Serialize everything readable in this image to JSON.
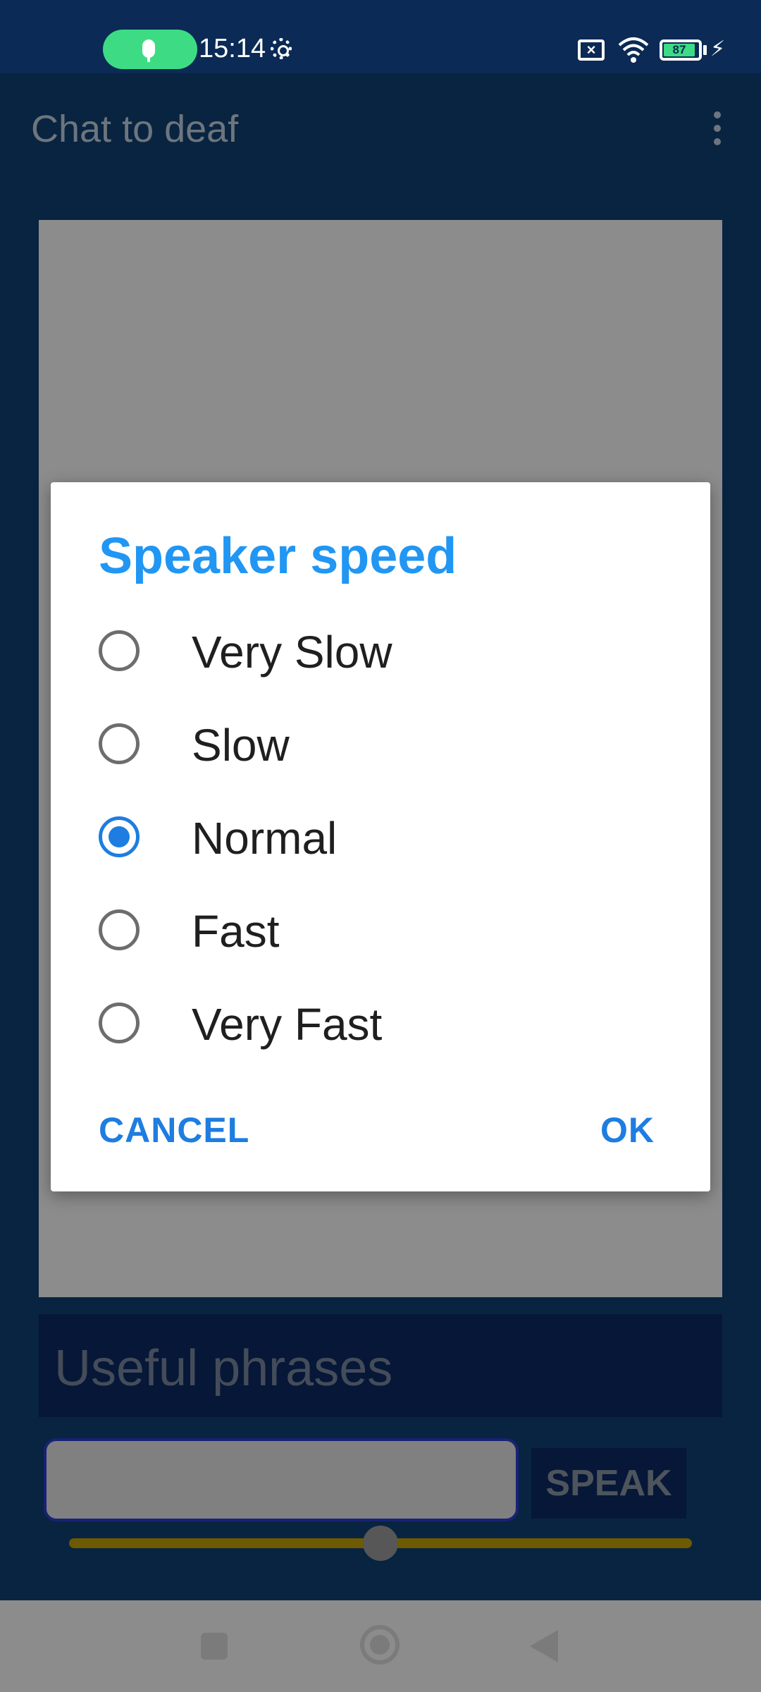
{
  "status_bar": {
    "time": "15:14",
    "battery_level": "87",
    "icons": [
      "microphone-icon",
      "settings-gear-icon",
      "no-sim-icon",
      "wifi-icon",
      "battery-icon",
      "charging-bolt-icon"
    ]
  },
  "app_bar": {
    "title": "Chat to deaf",
    "menu_icon": "more-vert-icon"
  },
  "main": {
    "phrases_label": "Useful phrases",
    "message_input_value": "",
    "speak_button": "SPEAK",
    "slider_value": 0.5
  },
  "dialog": {
    "title": "Speaker speed",
    "options": [
      {
        "label": "Very Slow",
        "selected": false
      },
      {
        "label": "Slow",
        "selected": false
      },
      {
        "label": "Normal",
        "selected": true
      },
      {
        "label": "Fast",
        "selected": false
      },
      {
        "label": "Very Fast",
        "selected": false
      }
    ],
    "cancel_label": "CANCEL",
    "ok_label": "OK"
  },
  "colors": {
    "accent": "#2196f3",
    "radio_selected": "#1e7de0",
    "app_bar": "#0f4277",
    "status_bar": "#0b2a55",
    "mic_pill": "#3ddc84"
  }
}
